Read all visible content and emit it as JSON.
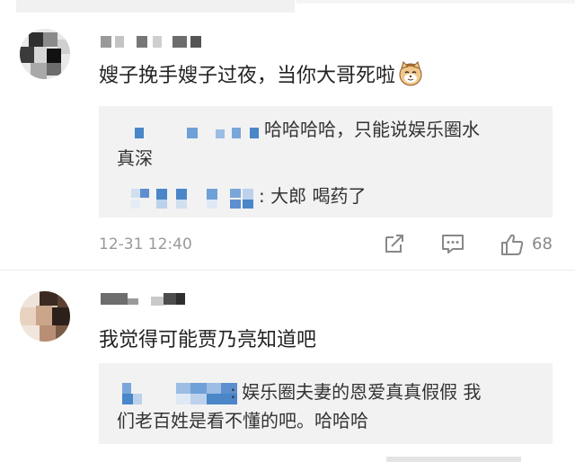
{
  "colors": {
    "background": "#ffffff",
    "reply_background": "#f2f2f2",
    "primary_text": "#222222",
    "meta_text": "#999999",
    "icon_gray": "#888888",
    "mosaic_blue": "#4a86c8"
  },
  "comments": [
    {
      "username": "",
      "text": "嫂子挽手嫂子过夜，当你大哥死啦",
      "emoji": "cat-face-icon",
      "replies": [
        {
          "line1": "哈哈哈哈，只能说娱乐圈水",
          "line2": "真深"
        },
        {
          "line1": ": 大郎 喝药了"
        }
      ],
      "time": "12-31 12:40",
      "actions": {
        "share_icon": "share-icon",
        "comment_icon": "comment-icon",
        "like_icon": "thumbs-up-icon",
        "like_count": "68"
      }
    },
    {
      "username": "",
      "text": "我觉得可能贾乃亮知道吧",
      "replies": [
        {
          "line1": ": 娱乐圈夫妻的恩爱真真假假  我",
          "line2": "们老百姓是看不懂的吧。哈哈哈"
        }
      ]
    }
  ]
}
